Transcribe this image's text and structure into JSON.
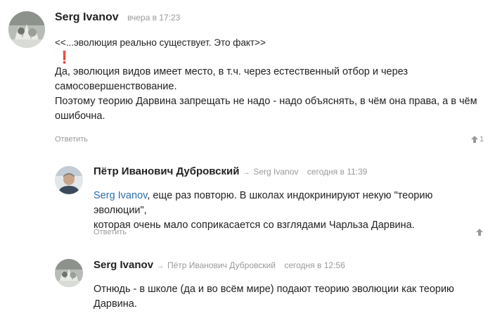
{
  "comments": [
    {
      "author": "Serg Ivanov",
      "time": "вчера в 17:23",
      "quote": "<<...эволюция реально существует. Это факт>>",
      "exclamation": "❗",
      "body_line1": "Да, эволюция видов имеет место, в т.ч. через естественный отбор и через",
      "body_line2": "самосовершенствование.",
      "body_line3": "Поэтому теорию Дарвина запрещать не надо - надо объяснять, в чём она права, а в чём",
      "body_line4": "ошибочна.",
      "reply_label": "Ответить",
      "votes": "1"
    },
    {
      "author": "Пётр Иванович Дубровский",
      "reply_arrow": "→",
      "reply_to": "Serg Ivanov",
      "time": "сегодня в 11:39",
      "mention": "Serg Ivanov",
      "body_line1_rest": ", еще раз повторю. В школах индокринируют некую \"теорию эволюции\",",
      "body_line2": "которая очень мало соприкасается со взглядами Чарльза Дарвина.",
      "reply_label": "Ответить"
    },
    {
      "author": "Serg Ivanov",
      "reply_arrow": "→",
      "reply_to": "Пётр Иванович Дубровский",
      "time": "сегодня в 12:56",
      "body_line1": "Отнюдь - в школе (да и во всём мире) подают теорию эволюции как теорию",
      "body_line2": "Дарвина."
    }
  ],
  "icons": {
    "vote_up": "arrow-up-icon",
    "exclamation": "exclamation-icon"
  },
  "colors": {
    "link": "#2b6ea8",
    "muted": "#999999",
    "exclamation": "#d0021b"
  }
}
